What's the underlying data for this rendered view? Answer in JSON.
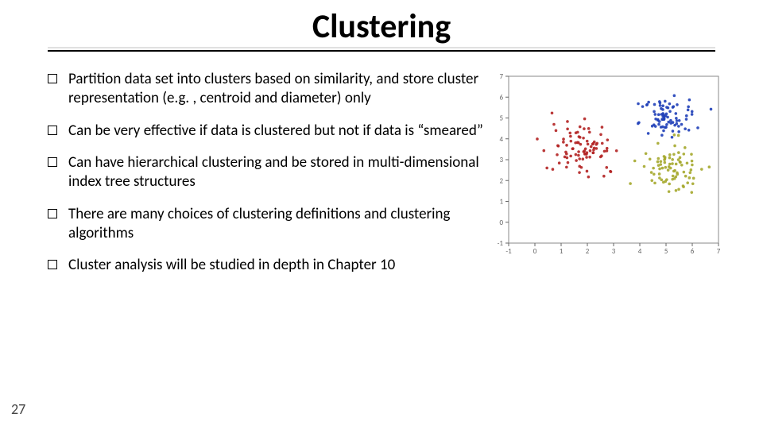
{
  "title": "Clustering",
  "bullets": [
    "Partition data set into clusters based on similarity, and store cluster representation (e.g. , centroid and diameter) only",
    "Can be very effective if data is clustered but not if data is “smeared”",
    "Can have hierarchical clustering and be stored in multi-dimensional index tree structures",
    "There are many choices of clustering definitions and clustering algorithms",
    "Cluster analysis will be studied in depth in Chapter 10"
  ],
  "page_number": "27",
  "chart_data": {
    "type": "scatter",
    "xlim": [
      -1,
      7
    ],
    "ylim": [
      -1,
      7
    ],
    "xticks": [
      -1,
      0,
      1,
      2,
      3,
      4,
      5,
      6,
      7
    ],
    "yticks": [
      -1,
      0,
      1,
      2,
      3,
      4,
      5,
      6,
      7
    ],
    "series": [
      {
        "name": "red",
        "color": "#b22222",
        "centroid": [
          1.8,
          3.5
        ],
        "spread": 1.4,
        "n": 90
      },
      {
        "name": "blue",
        "color": "#1f3fb8",
        "centroid": [
          5.0,
          5.0
        ],
        "spread": 1.1,
        "n": 80
      },
      {
        "name": "olive",
        "color": "#a5a82e",
        "centroid": [
          5.3,
          2.6
        ],
        "spread": 1.2,
        "n": 80
      }
    ]
  }
}
